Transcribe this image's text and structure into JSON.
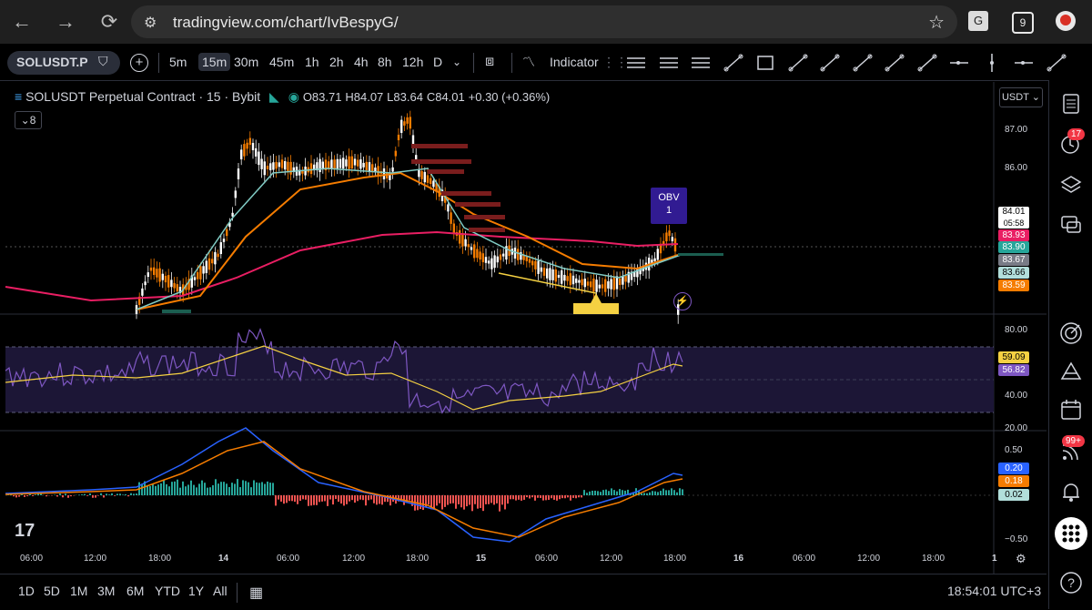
{
  "browser": {
    "url": "tradingview.com/chart/IvBespyG/",
    "tab_count": "9"
  },
  "toolbar": {
    "symbol": "SOLUSDT.P",
    "intervals": [
      "5m",
      "15m",
      "30m",
      "45m",
      "1h",
      "2h",
      "4h",
      "8h",
      "12h",
      "D"
    ],
    "active_interval": "15m",
    "indicators_label": "Indicator"
  },
  "legend": {
    "title": "SOLUSDT Perpetual Contract · 15 · Bybit",
    "open": "O83.71",
    "high": "H84.07",
    "low": "L83.64",
    "close": "C84.01",
    "change": "+0.30 (+0.36%)",
    "indicator_count": "8"
  },
  "currency": "USDT",
  "price_axis": {
    "ticks": [
      "87.00",
      "86.00"
    ],
    "tags": [
      {
        "value": "84.01",
        "sub": "05:58",
        "color": "#ffffff"
      },
      {
        "value": "83.93",
        "color": "#e91e63"
      },
      {
        "value": "83.90",
        "color": "#26a69a"
      },
      {
        "value": "83.67",
        "color": "#787b86"
      },
      {
        "value": "83.66",
        "color": "#b2dfdb"
      },
      {
        "value": "83.59",
        "color": "#f57c00"
      }
    ]
  },
  "rsi_axis": {
    "ticks": [
      "80.00",
      "40.00",
      "20.00"
    ],
    "tags": [
      {
        "value": "59.09",
        "color": "#f5d142"
      },
      {
        "value": "56.82",
        "color": "#7e57c2"
      }
    ]
  },
  "macd_axis": {
    "ticks": [
      "0.50",
      "−0.50"
    ],
    "tags": [
      {
        "value": "0.20",
        "color": "#2962ff"
      },
      {
        "value": "0.18",
        "color": "#f57c00"
      },
      {
        "value": "0.02",
        "color": "#b2dfdb"
      }
    ]
  },
  "obv_label": {
    "title": "OBV",
    "count": "1"
  },
  "time_axis": [
    "06:00",
    "12:00",
    "18:00",
    "14",
    "06:00",
    "12:00",
    "18:00",
    "15",
    "06:00",
    "12:00",
    "18:00",
    "16",
    "06:00",
    "12:00",
    "18:00",
    "1"
  ],
  "ranges": [
    "1D",
    "5D",
    "1M",
    "3M",
    "6M",
    "YTD",
    "1Y",
    "All"
  ],
  "clock": "18:54:01 UTC+3",
  "sidebar_badges": {
    "alerts": "17",
    "notifications": "99+"
  }
}
